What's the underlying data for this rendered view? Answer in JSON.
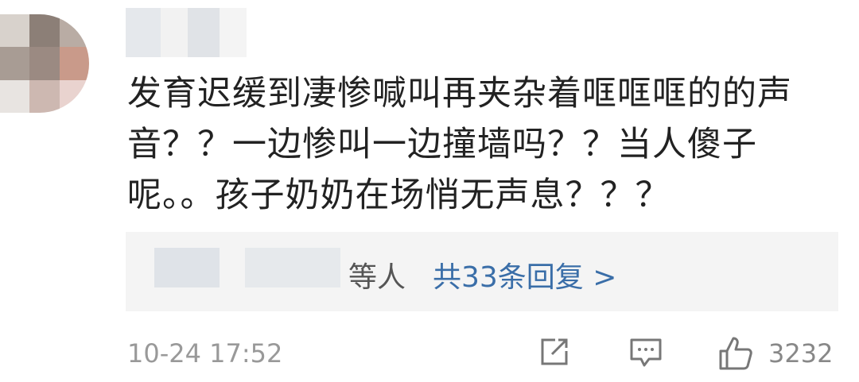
{
  "comment": {
    "text": "发育迟缓到凄惨喊叫再夹杂着哐哐哐的的声音？？一边惨叫一边撞墙吗？？当人傻子呢。。孩子奶奶在场悄无声息？？？",
    "avatar_colors": [
      "#d8d2cc",
      "#8c7f77",
      "#b9aca4",
      "#a89c94",
      "#9b8a82",
      "#c99a8a",
      "#e8e4e1",
      "#cdb8b1",
      "#e9d3cf"
    ],
    "username_colors": [
      "#e5e8ec",
      "#f2f2f2",
      "#e0e3e7",
      "#f4f4f4"
    ]
  },
  "replies": {
    "others_label": "等人",
    "link_label": "共33条回复 >"
  },
  "footer": {
    "timestamp": "10-24 17:52",
    "share_icon": "share-icon",
    "comment_icon": "comment-icon",
    "like_icon": "thumbs-up-icon",
    "like_count": "3232"
  }
}
